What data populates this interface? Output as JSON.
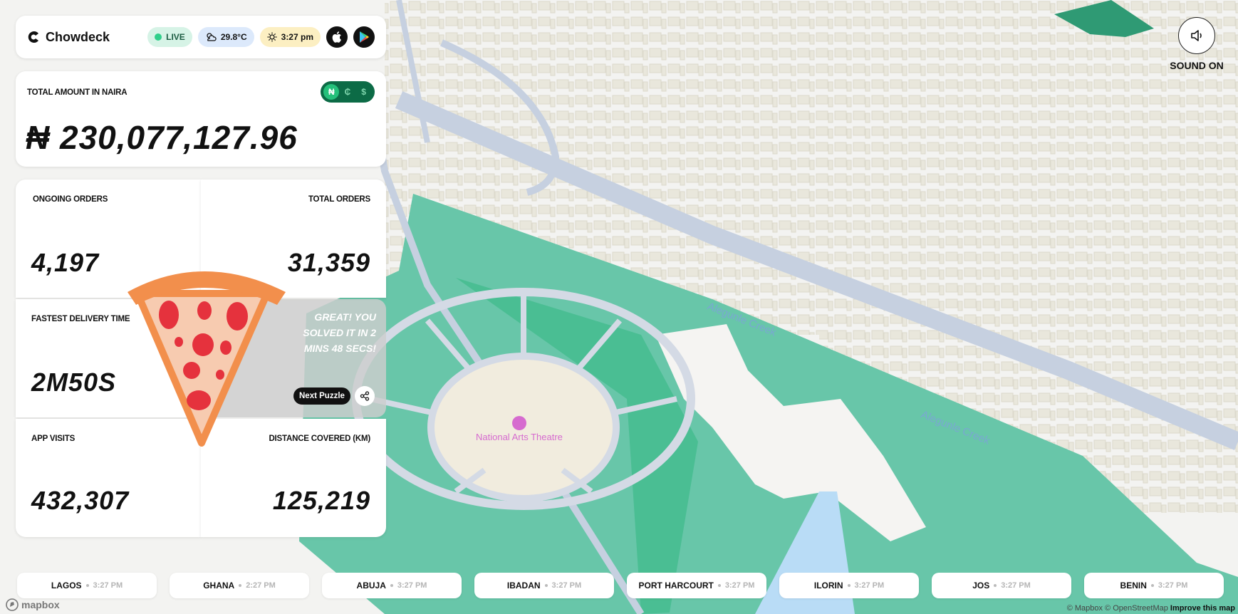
{
  "header": {
    "brand": "Chowdeck",
    "live_label": "LIVE",
    "weather": "29.8°C",
    "time": "3:27 pm",
    "icons": [
      "apple-icon",
      "google-play-icon"
    ]
  },
  "total": {
    "label": "TOTAL AMOUNT IN NAIRA",
    "value": "₦ 230,077,127.96",
    "currencies": [
      "₦",
      "₵",
      "$"
    ]
  },
  "stats": {
    "ongoing_label": "ONGOING ORDERS",
    "ongoing_value": "4,197",
    "total_orders_label": "TOTAL ORDERS",
    "total_orders_value": "31,359",
    "fastest_label": "FASTEST DELIVERY TIME",
    "fastest_value": "2M50S",
    "app_visits_label": "APP VISITS",
    "app_visits_value": "432,307",
    "distance_label": "DISTANCE COVERED (KM)",
    "distance_value": "125,219"
  },
  "puzzle": {
    "message": "GREAT! YOU SOLVED IT IN 2 MINS 48 SECS!",
    "next_label": "Next Puzzle"
  },
  "sound": {
    "label": "SOUND ON"
  },
  "map": {
    "poi": "National Arts Theatre",
    "creek_1": "Alegunle Creek",
    "creek_2": "Alegunle Creek",
    "mapbox": "mapbox",
    "attrib_1": "© Mapbox © OpenStreetMap",
    "attrib_2": "Improve this map",
    "colors": {
      "park": "#68c6a9",
      "water": "#b9dcf6",
      "road": "#c6d0e0",
      "building": "#ecebe2"
    }
  },
  "cities": [
    {
      "name": "LAGOS",
      "time": "3:27 PM"
    },
    {
      "name": "GHANA",
      "time": "2:27 PM"
    },
    {
      "name": "ABUJA",
      "time": "3:27 PM"
    },
    {
      "name": "IBADAN",
      "time": "3:27 PM"
    },
    {
      "name": "PORT HARCOURT",
      "time": "3:27 PM"
    },
    {
      "name": "ILORIN",
      "time": "3:27 PM"
    },
    {
      "name": "JOS",
      "time": "3:27 PM"
    },
    {
      "name": "BENIN",
      "time": "3:27 PM"
    }
  ]
}
